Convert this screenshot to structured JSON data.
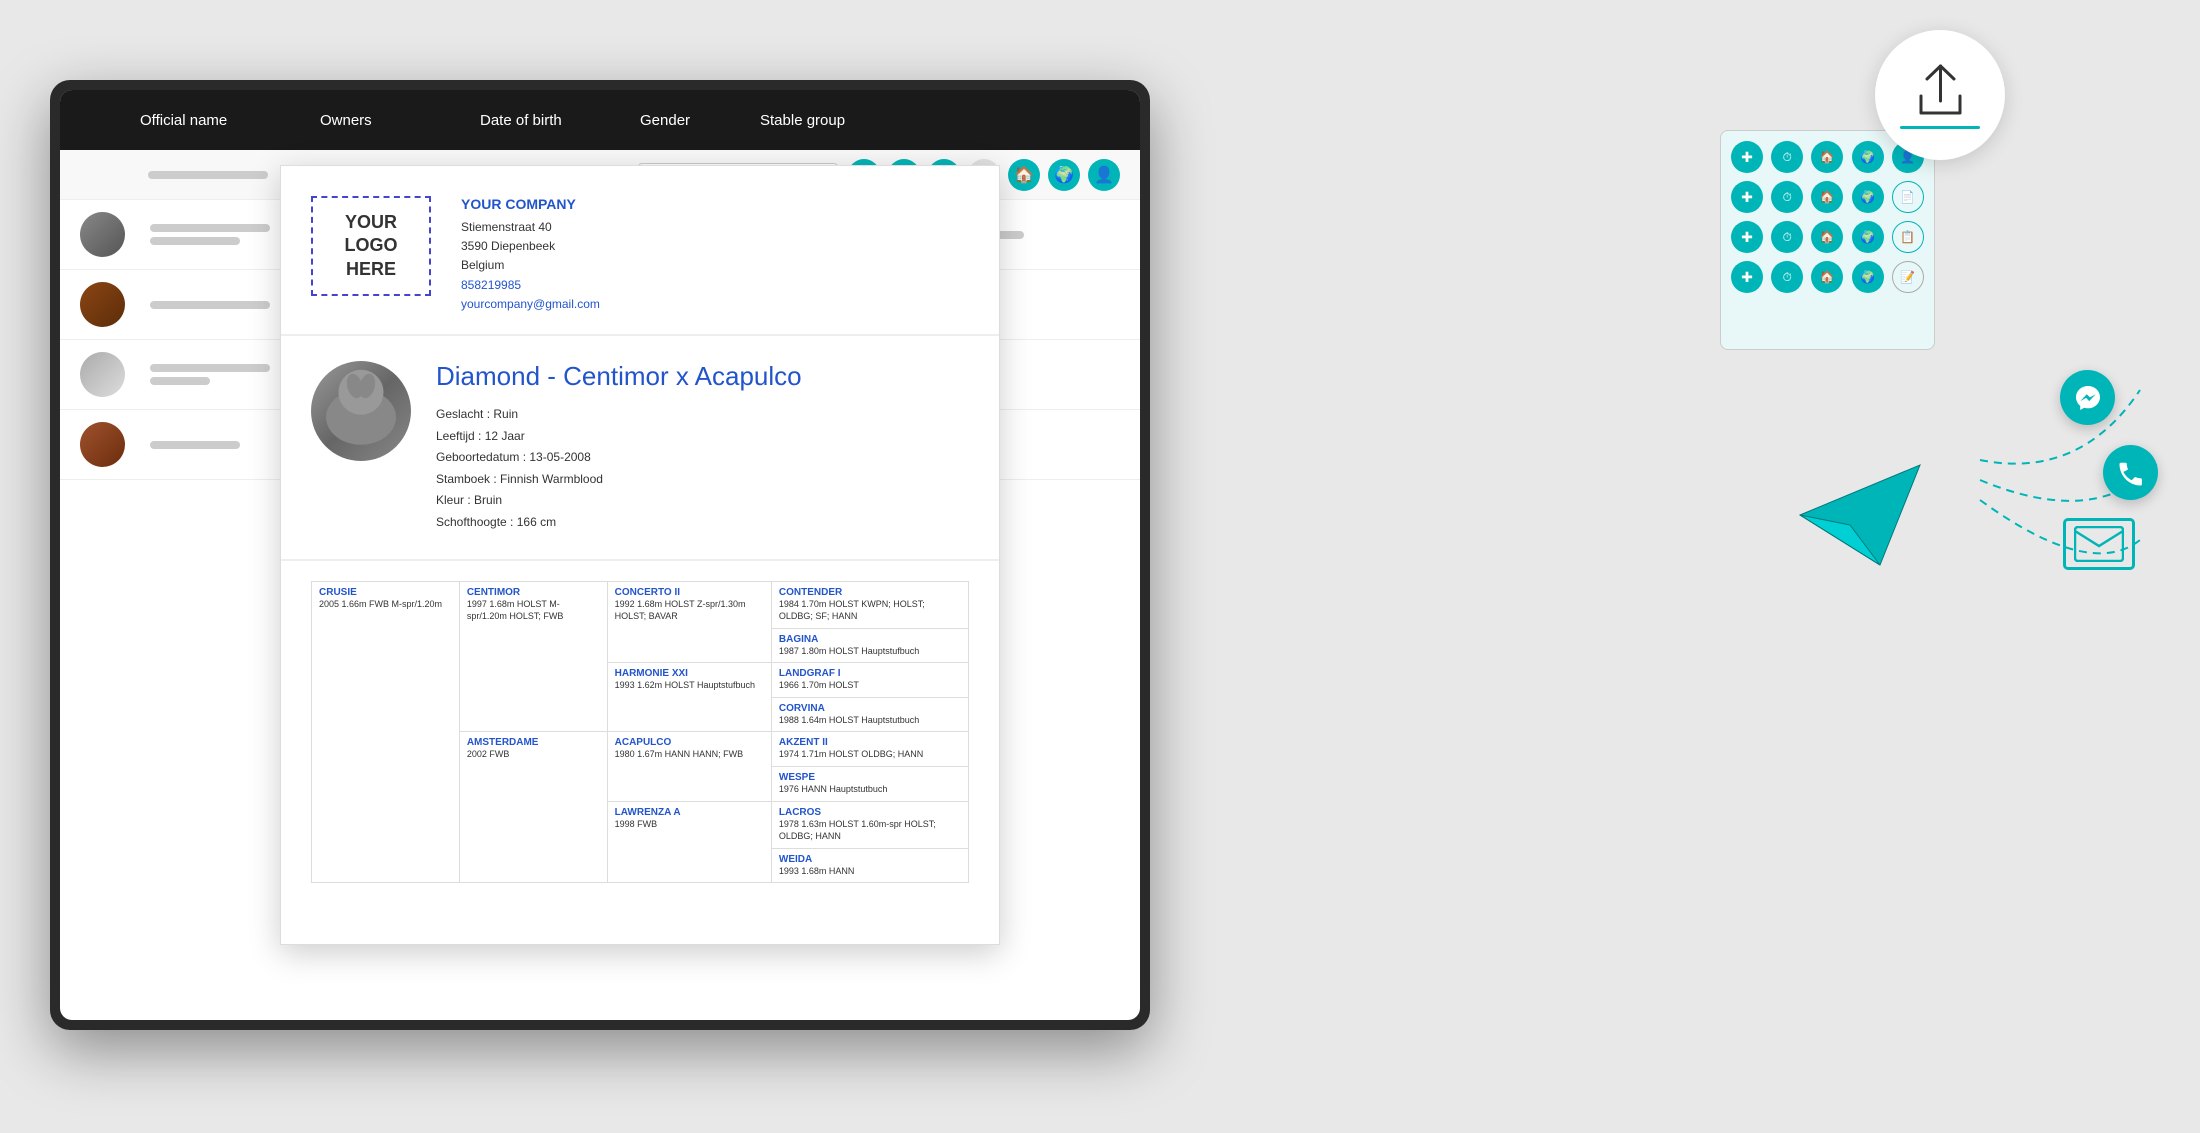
{
  "colors": {
    "teal": "#00b5b8",
    "dark": "#1a1a1a",
    "blue_link": "#2255cc",
    "text_dark": "#333",
    "gray_line": "#cccccc"
  },
  "table": {
    "headers": [
      "Official name",
      "Owners",
      "Date of birth",
      "Gender",
      "Stable group"
    ],
    "rows": [
      {
        "avatar": "gray",
        "lines": [
          "long",
          "medium",
          "short",
          "medium"
        ]
      },
      {
        "avatar": "brown",
        "lines": [
          "long",
          "medium",
          "short"
        ]
      },
      {
        "avatar": "white",
        "lines": [
          "long",
          "medium",
          "long"
        ]
      },
      {
        "avatar": "dark",
        "lines": [
          "long",
          "medium",
          "short"
        ]
      }
    ]
  },
  "pdf": {
    "logo": {
      "line1": "YOUR",
      "line2": "LOGO",
      "line3": "HERE"
    },
    "company": {
      "name": "YOUR COMPANY",
      "street": "Stiemenstraat 40",
      "city": "3590 Diepenbeek",
      "country": "Belgium",
      "phone": "858219985",
      "email": "yourcompany@gmail.com"
    },
    "horse": {
      "name": "Diamond - Centimor x Acapulco",
      "gender": "Geslacht : Ruin",
      "age": "Leeftijd : 12 Jaar",
      "dob": "Geboortedatum : 13-05-2008",
      "studbook": "Stamboek : Finnish Warmblood",
      "color": "Kleur : Bruin",
      "height": "Schofthoogte : 166 cm"
    },
    "pedigree": {
      "left_col": [
        {
          "name": "CRUSIE",
          "detail": "2005 1.66m FWB M-spr/1.20m"
        }
      ],
      "mid_col": [
        {
          "name": "CENTIMOR",
          "detail": "1997 1.68m HOLST M-spr/1.20m HOLST; FWB"
        },
        {
          "name": "AMSTERDAME",
          "detail": "2002 FWB"
        }
      ],
      "mid2_col": [
        {
          "name": "CONCERTO II",
          "detail": "1992 1.68m HOLST Z-spr/1.30m HOLST; BAVAR"
        },
        {
          "name": "HARMONIE XXI",
          "detail": "1993 1.62m HOLST Hauptstufbuch"
        },
        {
          "name": "ACAPULCO",
          "detail": "1980 1.67m HANN HANN; FWB"
        },
        {
          "name": "LAWRENZA A",
          "detail": "1998 FWB"
        }
      ],
      "right_col": [
        {
          "name": "CONTENDER",
          "detail": "1984 1.70m HOLST\nKWPN; HOLST; OLDBG; SF; HANN"
        },
        {
          "name": "BAGINA",
          "detail": "1987 1.80m HOLST Hauptstufbuch"
        },
        {
          "name": "LANDGRAF I",
          "detail": "1966 1.70m HOLST"
        },
        {
          "name": "CORVINA",
          "detail": "1988 1.64m HOLST Hauptstutbuch"
        },
        {
          "name": "AKZENT II",
          "detail": "1974 1.71m HOLST OLDBG; HANN"
        },
        {
          "name": "WESPE",
          "detail": "1976 HANN Hauptstutbuch"
        },
        {
          "name": "LACROS",
          "detail": "1978 1.63m HOLST 1.60m-spr\nHOLST; OLDBG; HANN"
        },
        {
          "name": "WEIDA",
          "detail": "1993 1.68m HANN"
        }
      ]
    }
  },
  "panel_icons": [
    "✚",
    "⏱",
    "🏠",
    "🌍",
    "👤",
    "✚",
    "⏱",
    "🏠",
    "🌍",
    "📄",
    "✚",
    "⏱",
    "🏠",
    "🌍",
    "📋",
    "✚",
    "⏱",
    "🏠",
    "🌍",
    "📝"
  ],
  "upload": {
    "icon_label": "share-icon"
  }
}
